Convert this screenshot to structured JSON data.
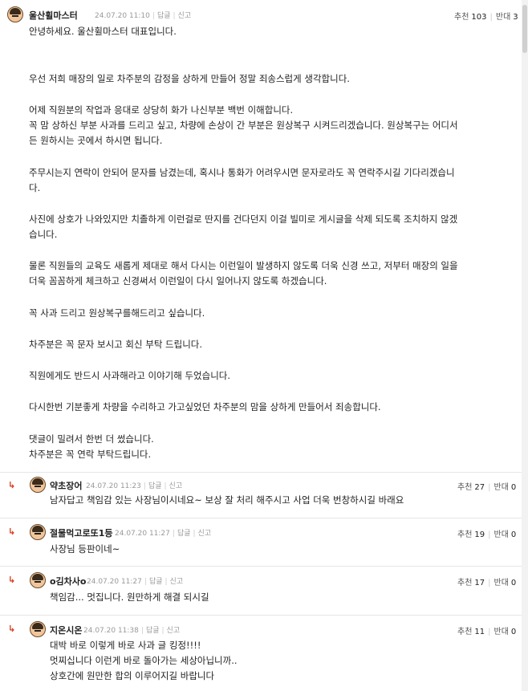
{
  "main": {
    "nickname": "울산휠마스터",
    "date": "24.07.20 11:10",
    "reply_label": "답글",
    "report_label": "신고",
    "upvote_label": "추천",
    "upvote_count": "103",
    "downvote_label": "반대",
    "downvote_count": "3",
    "lines": [
      "안녕하세요. 울산휠마스터 대표입니다.",
      "우선 저희 매장의 일로 차주분의 감정을 상하게 만들어 정말 죄송스럽게 생각합니다.",
      "어제 직원분의 작업과 응대로 상당히 화가 나신부분 백번 이해합니다.",
      "꼭 맘 상하신 부분 사과를 드리고 싶고, 차량에 손상이 간 부분은 원상복구 시켜드리겠습니다. 원상복구는 어디서",
      "든 원하시는 곳에서 하시면 됩니다.",
      "주무시는지 연락이 안되어 문자를 남겼는데, 혹시나 통화가 어려우시면 문자로라도 꼭 연락주시길 기다리겠습니",
      "다.",
      "사진에 상호가 나와있지만 치졸하게 이런걸로 딴지를 건다던지 이걸 빌미로 게시글을 삭제 되도록 조치하지 않겠",
      "습니다.",
      "물론 직원들의 교육도 새롭게 제대로 해서 다시는 이런일이 발생하지 않도록 더욱 신경 쓰고, 저부터 매장의 일을",
      "더욱 꼼꼼하게 체크하고 신경써서 이런일이 다시 일어나지 않도록 하겠습니다.",
      "꼭 사과 드리고 원상복구를해드리고 싶습니다.",
      "차주분은 꼭 문자 보시고 회신 부탁 드립니다.",
      "직원에게도 반드시 사과해라고 이야기해 두었습니다.",
      "다시한번 기분좋게 차량을 수리하고 가고싶었던 차주분의 맘을 상하게 만들어서 죄송합니다.",
      "댓글이 밀려서 한번 더 썼습니다.",
      "차주분은 꼭 연락 부탁드립니다."
    ]
  },
  "replies": [
    {
      "nickname": "약초장어",
      "date": "24.07.20 11:23",
      "reply_label": "답글",
      "report_label": "신고",
      "upvote_label": "추천",
      "upvote_count": "27",
      "downvote_label": "반대",
      "downvote_count": "0",
      "lines": [
        "남자답고 책임감 있는 사장님이시네요~ 보상 잘 처리 해주시고 사업 더욱 번창하시길 바래요"
      ]
    },
    {
      "nickname": "절물먹고로또1등",
      "date": "24.07.20 11:27",
      "reply_label": "답글",
      "report_label": "신고",
      "upvote_label": "추천",
      "upvote_count": "19",
      "downvote_label": "반대",
      "downvote_count": "0",
      "lines": [
        "사장님 등판이네~"
      ]
    },
    {
      "nickname": "o김차사o",
      "date": "24.07.20 11:27",
      "reply_label": "답글",
      "report_label": "신고",
      "upvote_label": "추천",
      "upvote_count": "17",
      "downvote_label": "반대",
      "downvote_count": "0",
      "lines": [
        "책임감... 멋집니다. 원만하게 해결 되시길"
      ]
    },
    {
      "nickname": "지온시온",
      "date": "24.07.20 11:38",
      "reply_label": "답글",
      "report_label": "신고",
      "upvote_label": "추천",
      "upvote_count": "11",
      "downvote_label": "반대",
      "downvote_count": "0",
      "lines": [
        "대박 바로 이렇게 바로 사과 글 킹정!!!!",
        "멋찌십니다 이런게 바로 돌아가는 세상아닙니까..",
        "상호간에 원만한 합의 이루어지길 바랍니다"
      ]
    }
  ],
  "colors": {
    "reply_arrow": "#d6391b",
    "divider": "#e6e6e6",
    "meta_text": "#999999"
  },
  "icons": {
    "reply_arrow": "reply-arrow-icon",
    "avatar": "avatar-icon"
  }
}
